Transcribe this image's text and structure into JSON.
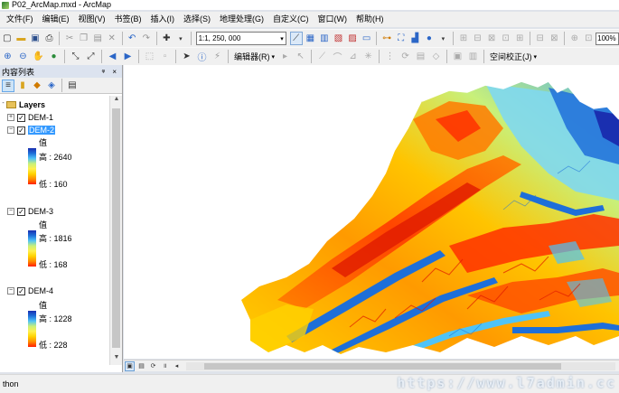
{
  "window": {
    "title": "P02_ArcMap.mxd - ArcMap"
  },
  "menu": [
    "文件(F)",
    "编辑(E)",
    "视图(V)",
    "书签(B)",
    "插入(I)",
    "选择(S)",
    "地理处理(G)",
    "自定义(C)",
    "窗口(W)",
    "帮助(H)"
  ],
  "toolbar": {
    "scale_value": "1:1, 250, 000",
    "zoom_value": "100%",
    "editor_label": "编辑器(R)",
    "spatial_adjust_label": "空间校正(J)"
  },
  "toc": {
    "title": "内容列表",
    "pin_close": "ᵠ ×",
    "layers_label": "Layers",
    "layers": [
      {
        "name": "DEM-1",
        "expanded": false,
        "checked": true,
        "selected": false
      },
      {
        "name": "DEM-2",
        "expanded": true,
        "checked": true,
        "selected": true,
        "legend_title": "值",
        "high": "高 : 2640",
        "low": "低 : 160"
      },
      {
        "name": "DEM-3",
        "expanded": true,
        "checked": true,
        "selected": false,
        "legend_title": "值",
        "high": "高 : 1816",
        "low": "低 : 168"
      },
      {
        "name": "DEM-4",
        "expanded": true,
        "checked": true,
        "selected": false,
        "legend_title": "值",
        "high": "高 : 1228",
        "low": "低 : 228"
      }
    ]
  },
  "colors": {
    "ramp": [
      "#ff1e00",
      "#ff8c00",
      "#ffd200",
      "#fff04e",
      "#c8f07a",
      "#4fc3f7",
      "#1e6fd9",
      "#1a2fb0"
    ],
    "selection": "#3399ff",
    "panel_bg": "#f0f0f0"
  },
  "status": {
    "text": "thon"
  },
  "watermark": "https://www.l7admin.cc"
}
